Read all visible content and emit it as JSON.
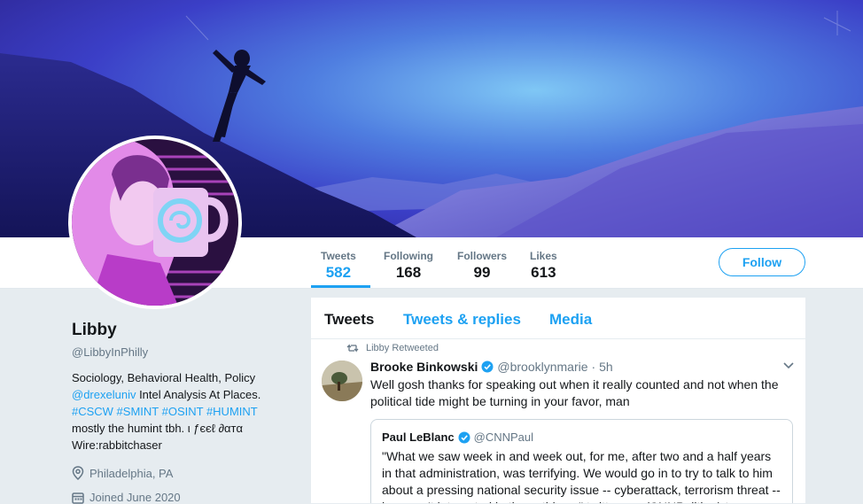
{
  "profile": {
    "name": "Libby",
    "handle": "@LibbyInPhilly",
    "bio_line1": "Sociology, Behavioral Health, Policy",
    "bio_link": "@drexeluniv",
    "bio_line2_rest": " Intel Analysis At Places.",
    "bio_hashtags": "#CSCW #SMINT #OSINT #HUMINT",
    "bio_line4": "mostly the humint tbh. ι ƒєєℓ ∂αтα",
    "bio_line5": "Wire:rabbitchaser",
    "location": "Philadelphia, PA",
    "joined": "Joined June 2020",
    "location_icon": "map-pin-icon",
    "joined_icon": "calendar-icon"
  },
  "stats": [
    {
      "label": "Tweets",
      "value": "582"
    },
    {
      "label": "Following",
      "value": "168"
    },
    {
      "label": "Followers",
      "value": "99"
    },
    {
      "label": "Likes",
      "value": "613"
    }
  ],
  "follow_label": "Follow",
  "tabs": [
    "Tweets",
    "Tweets & replies",
    "Media"
  ],
  "tweet": {
    "retweet_note": "Libby Retweeted",
    "author_name": "Brooke Binkowski",
    "author_handle": "@brooklynmarie",
    "time": "· 5h",
    "text": "Well gosh thanks for speaking out when it really counted and not when the political tide might be turning in your favor, man",
    "quote": {
      "author_name": "Paul LeBlanc",
      "author_handle": "@CNNPaul",
      "text": "\"What we saw week in and week out, for me, after two and a half years in that administration, was terrifying. We would go in to try to talk to him about a pressing national security issue -- cyberattack, terrorism threat -- he wasn't interested in those things.\" twitter.com/CNNPolitics/st..."
    }
  },
  "colors": {
    "accent": "#1da1f2",
    "background": "#e6ecf0",
    "secondary_text": "#657786",
    "banner": "#3b3fc7",
    "avatar_tint": "#c84fd8"
  }
}
